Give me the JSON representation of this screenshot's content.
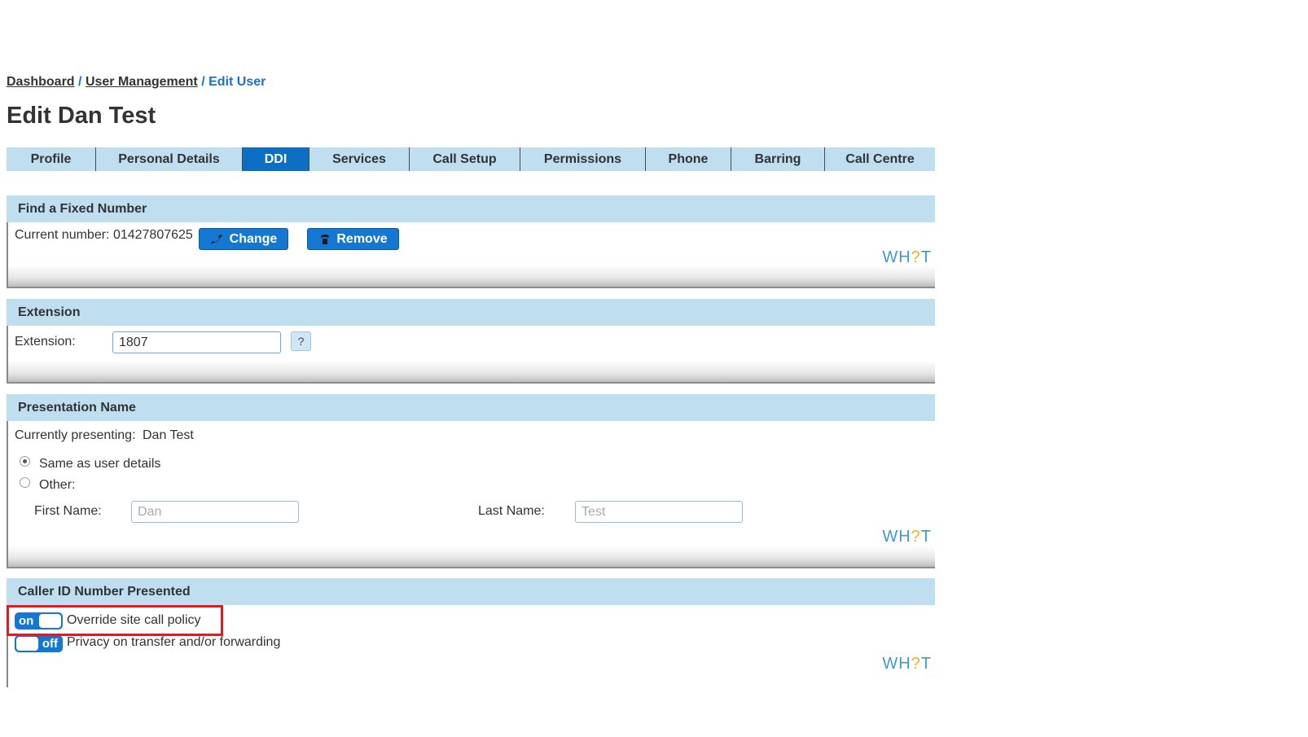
{
  "breadcrumb": {
    "dashboard": "Dashboard",
    "sep1": "/",
    "user_management": "User Management",
    "sep2": "/",
    "current": "Edit User"
  },
  "page_title": "Edit Dan Test",
  "tabs": [
    {
      "label": "Profile",
      "active": false
    },
    {
      "label": "Personal Details",
      "active": false
    },
    {
      "label": "DDI",
      "active": true
    },
    {
      "label": "Services",
      "active": false
    },
    {
      "label": "Call Setup",
      "active": false
    },
    {
      "label": "Permissions",
      "active": false
    },
    {
      "label": "Phone",
      "active": false
    },
    {
      "label": "Barring",
      "active": false
    },
    {
      "label": "Call Centre",
      "active": false
    }
  ],
  "whot": {
    "prefix": "WH",
    "q": "?",
    "suffix": "T"
  },
  "fixed_number": {
    "title": "Find a Fixed Number",
    "current_label": "Current number: 01427807625",
    "change_label": "Change",
    "remove_label": "Remove"
  },
  "extension": {
    "title": "Extension",
    "label": "Extension:",
    "value": "1807",
    "help": "?"
  },
  "presentation": {
    "title": "Presentation Name",
    "currently_label": "Currently presenting:",
    "currently_value": "Dan Test",
    "same_label": "Same as user details",
    "other_label": "Other:",
    "first_name_label": "First Name:",
    "first_name_value": "Dan",
    "last_name_label": "Last Name:",
    "last_name_value": "Test"
  },
  "caller_id": {
    "title": "Caller ID Number Presented",
    "override_state": "on",
    "override_label": "Override site call policy",
    "privacy_state": "off",
    "privacy_label": "Privacy on transfer and/or forwarding"
  },
  "colors": {
    "accent": "#1478d2",
    "tab_bar": "#bfdff0",
    "tab_active": "#0d6fc4",
    "link_blue": "#1a73c8",
    "highlight": "#e01b22"
  }
}
